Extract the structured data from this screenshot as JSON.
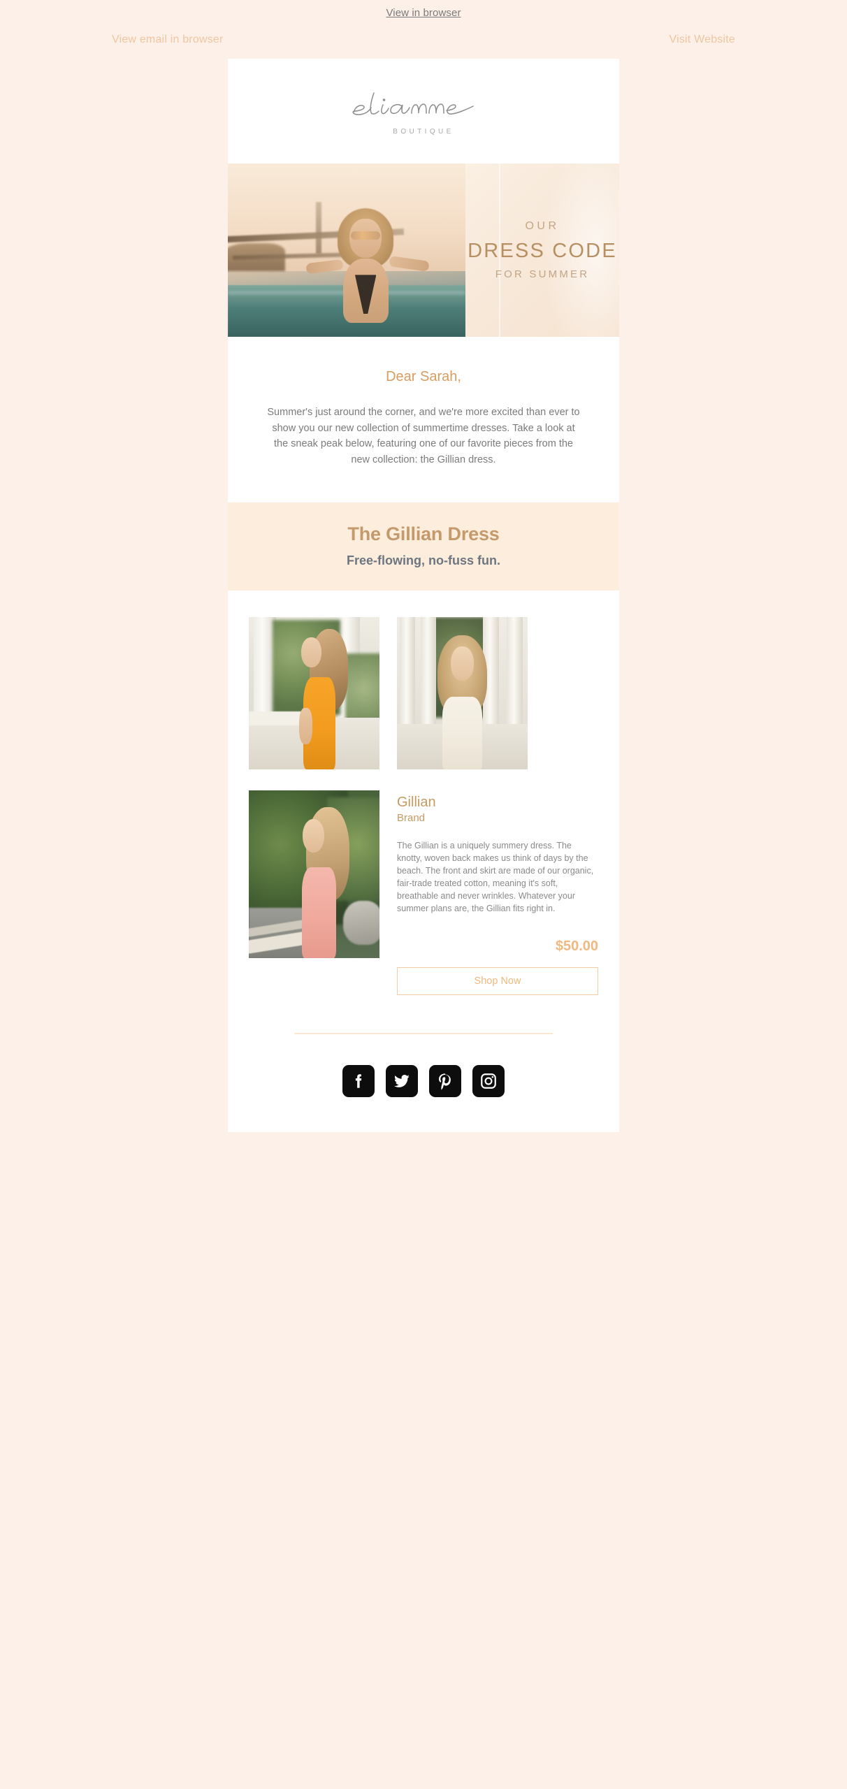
{
  "preheader": {
    "view_in_browser": "View in browser"
  },
  "toplinks": {
    "left": "View email in browser",
    "right": "Visit Website"
  },
  "brand": {
    "name": "elianne",
    "tagline": "BOUTIQUE"
  },
  "hero": {
    "eyebrow": "OUR",
    "headline": "DRESS  CODE",
    "subline": "FOR SUMMER"
  },
  "intro": {
    "greeting": "Dear Sarah,",
    "body": "Summer's just around the corner, and we're more excited than ever to show you our new collection of summertime dresses. Take a look at the sneak peak below, featuring one of our favorite pieces from the new collection: the Gillian dress."
  },
  "band": {
    "title": "The Gillian Dress",
    "subtitle": "Free-flowing, no-fuss fun."
  },
  "product": {
    "name": "Gillian",
    "brand": "Brand",
    "description": "The Gillian is a uniquely summery dress. The knotty, woven back makes us think of days by the beach. The front and skirt are made of our organic, fair-trade treated cotton, meaning it's soft, breathable and never wrinkles. Whatever your summer plans are, the Gillian fits right in.",
    "price": "$50.00",
    "cta": "Shop Now"
  },
  "gallery": [
    {
      "alt": "model-in-orange-dress"
    },
    {
      "alt": "model-in-cream-dress"
    },
    {
      "alt": "model-in-pink-dress"
    }
  ],
  "social": [
    {
      "network": "facebook"
    },
    {
      "network": "twitter"
    },
    {
      "network": "pinterest"
    },
    {
      "network": "instagram"
    }
  ],
  "colors": {
    "page_background": "#FCF0E8",
    "card_background": "#FFFFFF",
    "band_background": "#FDEDDC",
    "accent_gold": "#C49A6C",
    "accent_peach": "#EFB97F",
    "link_peach": "#F0C6A0",
    "heading_slate": "#6D7680",
    "body_gray": "#7B7B7B",
    "social_icon": "#0D0D0D"
  }
}
